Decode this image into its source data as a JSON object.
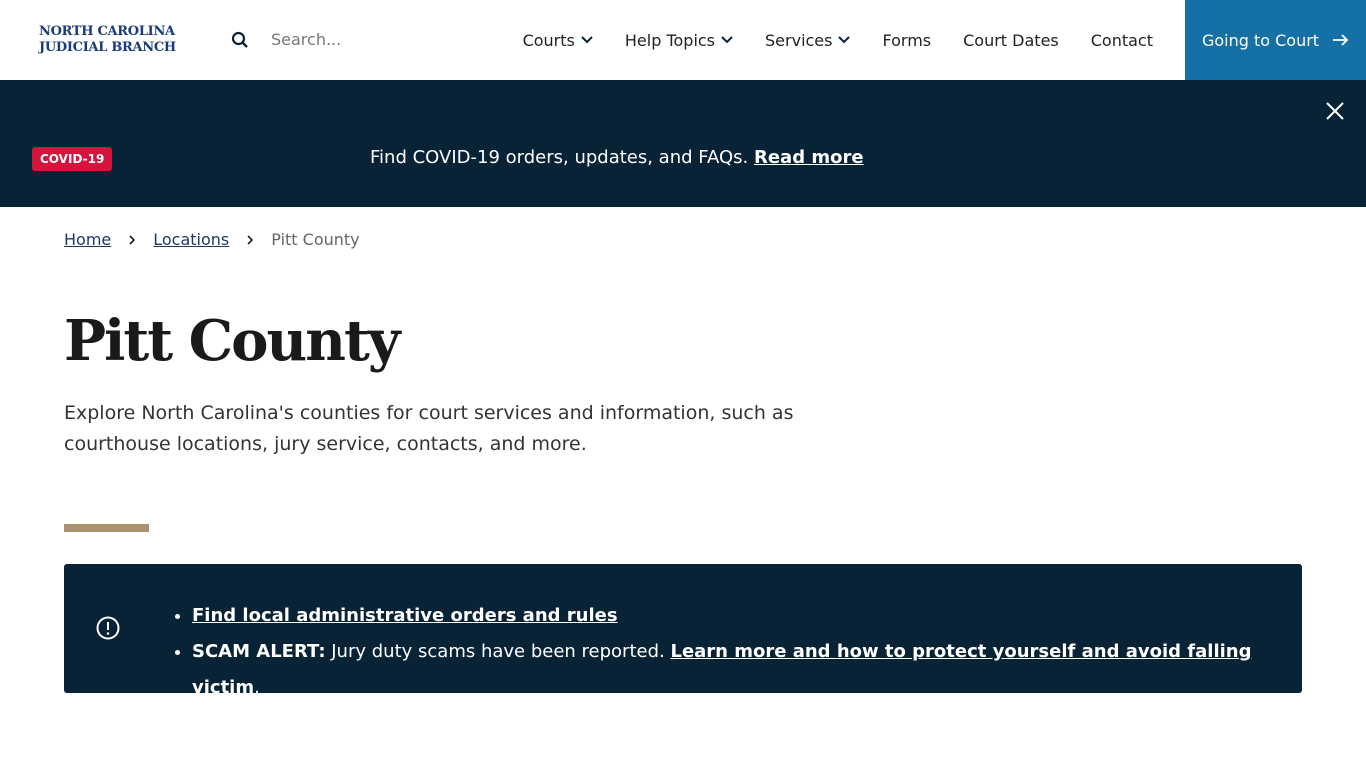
{
  "header": {
    "logo_line1": "NORTH CAROLINA",
    "logo_line2": "JUDICIAL BRANCH",
    "search_placeholder": "Search...",
    "nav": [
      {
        "label": "Courts"
      },
      {
        "label": "Help Topics"
      },
      {
        "label": "Services"
      },
      {
        "label": "Forms"
      },
      {
        "label": "Court Dates"
      },
      {
        "label": "Contact"
      }
    ],
    "cta": "Going to Court"
  },
  "banner": {
    "badge": "COVID-19",
    "message": "Find COVID-19 orders, updates, and FAQs.",
    "link": "Read more"
  },
  "breadcrumb": {
    "home": "Home",
    "locations": "Locations",
    "current": "Pitt County"
  },
  "page": {
    "title": "Pitt County",
    "intro": "Explore North Carolina's counties for court services and information, such as courthouse locations, jury service, contacts, and more."
  },
  "alert": {
    "item1_link": "Find local administrative orders and rules",
    "item2_label": "SCAM ALERT:",
    "item2_text": " Jury duty scams have been reported. ",
    "item2_link": "Learn more and how to protect yourself and avoid falling victim",
    "item2_end": "."
  },
  "colors": {
    "navy": "#082236",
    "accent": "#1570a6",
    "badge": "#d4143d",
    "rule": "#a89070"
  }
}
